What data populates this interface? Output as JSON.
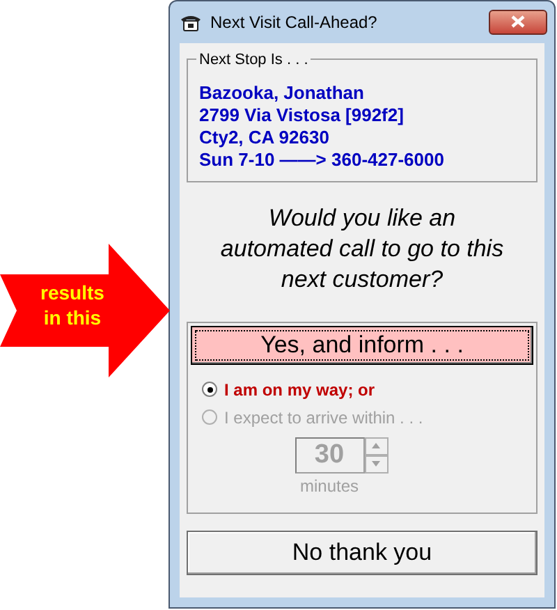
{
  "callout": {
    "text": "results in this"
  },
  "window": {
    "title": "Next Visit Call-Ahead?"
  },
  "next_stop": {
    "legend": "Next Stop Is . . .",
    "lines": [
      "Bazooka, Jonathan",
      "2799 Via Vistosa [992f2]",
      "Cty2, CA 92630",
      "Sun 7-10 ——> 360-427-6000"
    ]
  },
  "question": "Would you like an automated call to go to this next customer?",
  "yes_button": {
    "label": "Yes, and inform . . ."
  },
  "options": [
    {
      "label": "I am on my way; or",
      "selected": true,
      "disabled": false
    },
    {
      "label": "I expect to arrive within . . .",
      "selected": false,
      "disabled": true
    }
  ],
  "minutes": {
    "value": "30",
    "unit": "minutes",
    "disabled": true
  },
  "no_button": {
    "label": "No thank you"
  }
}
